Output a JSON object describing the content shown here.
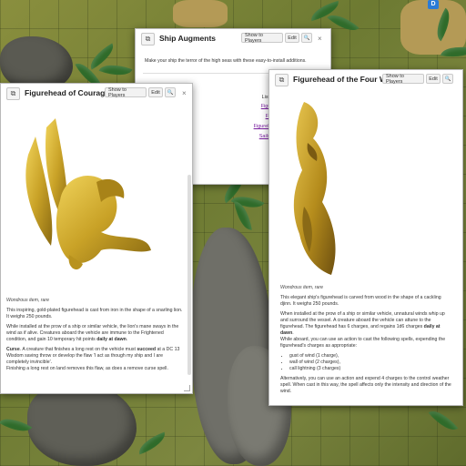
{
  "map": {
    "badge": "D"
  },
  "ship_augments": {
    "title": "Ship Augments",
    "show_label": "Show to Players",
    "edit_label": "Edit",
    "intro": "Make your ship the terror of the high seas with these easy-to-install additions.",
    "list_title": "List of Ship Augments:",
    "links": [
      "Figurehead of Courage",
      "Figurehead of Fear",
      "Figurehead of the Four Winds",
      "Sails of Swift Vengeance"
    ]
  },
  "courage": {
    "title": "Figurehead of Courage",
    "show_label": "Show to Players",
    "edit_label": "Edit",
    "subtitle": "Wondrous item, rare",
    "p1": "This inspiring, gold-plated figurehead is cast from iron in the shape of a snarling lion. It weighs 250 pounds.",
    "p2_a": "While installed at the prow of a ship or similar vehicle, the lion's mane sways in the wind as if alive. Creatures aboard the vehicle are immune to the Frightened condition, and gain 10 temporary hit points ",
    "p2_b": "daily at dawn",
    "p2_c": ".",
    "p3_label": "Curse",
    "p3_a": ". A creature that finishes a long rest on the vehicle must ",
    "p3_b": "succeed",
    "p3_c": " at a DC 13 Wisdom saving throw or develop the flaw 'I act as though my ship and I are completely invincible'.",
    "p4": "Finishing a long rest on land removes this flaw, as does a remove curse spell."
  },
  "winds": {
    "title": "Figurehead of the Four Winds",
    "show_label": "Show to Players",
    "edit_label": "Edit",
    "subtitle": "Wondrous item, rare",
    "p1": "This elegant ship's figurehead is carved from wood in the shape of a cackling djinn. It weighs 250 pounds.",
    "p2_a": "When installed at the prow of a ship or similar vehicle, unnatural winds whip up and surround the vessel. A creature aboard the vehicle can attune to the figurehead. The figurehead has 6 charges, and regains 1d6 charges ",
    "p2_b": "daily at dawn",
    "p2_c": ".",
    "p3": "While aboard, you can use an action to cast the following spells, expending the figurehead's charges as appropriate:",
    "spells": [
      "gust of wind (1 charge),",
      "wall of wind (2 charges),",
      "call lightning (3 charges)"
    ],
    "p4": "Alternatively, you can use an action and expend 4 charges to the control weather spell. When cast in this way, the spell affects only the intensity and direction of the wind."
  },
  "colors": {
    "link": "#7a1fa0",
    "gold": "#c9a227"
  }
}
